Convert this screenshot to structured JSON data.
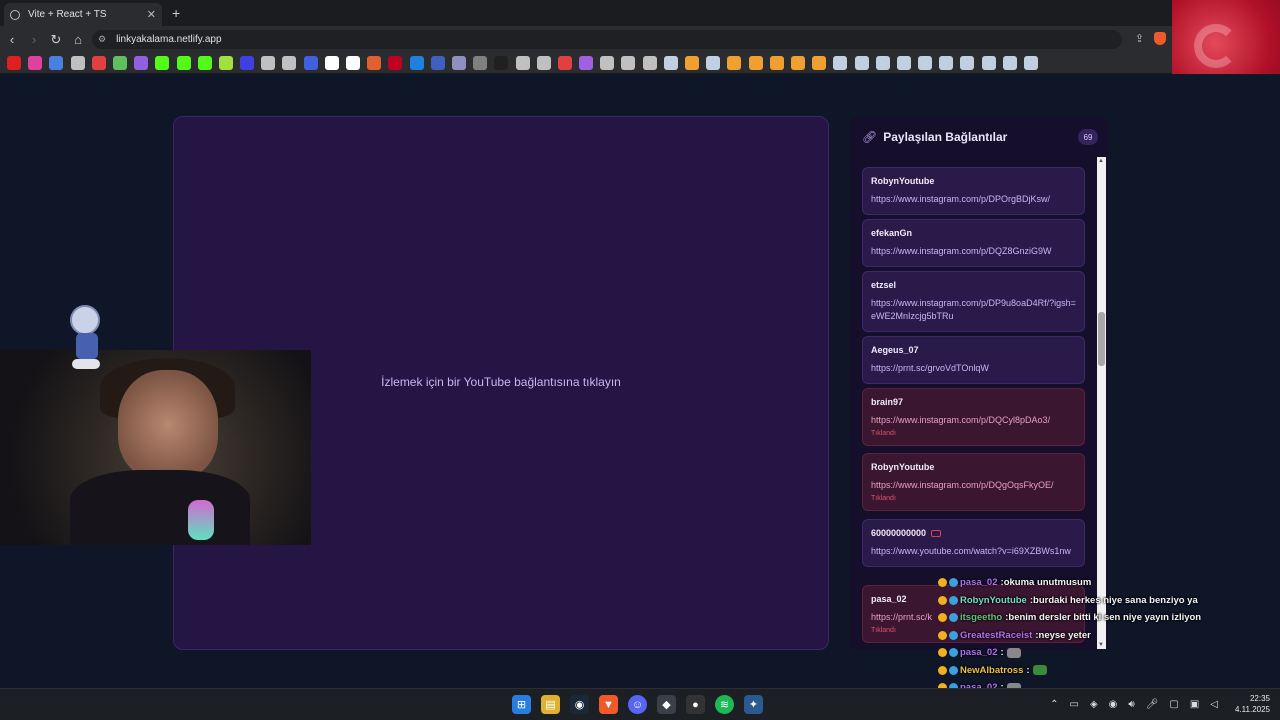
{
  "browser": {
    "tab_title": "Vite + React + TS",
    "tab_close": "✕",
    "new_tab": "+",
    "url": "linkyakalama.netlify.app",
    "back": "‹",
    "forward": "›",
    "reload": "↻",
    "bookmark_colors": [
      "#e02020",
      "#e040a0",
      "#4a80e0",
      "#c0c0c0",
      "#e04040",
      "#60c060",
      "#9060e0",
      "#53fc18",
      "#53fc18",
      "#53fc18",
      "#a0e040",
      "#4040e0",
      "#c0c0c0",
      "#c0c0c0",
      "#4060e0",
      "#ffffff",
      "#ffffff",
      "#e06030",
      "#c00020",
      "#2080e0",
      "#4060c0",
      "#9090c0",
      "#808080",
      "#202020",
      "#c0c0c0",
      "#c0c0c0",
      "#e04040",
      "#a060e0",
      "#c0c0c0",
      "#c0c0c0",
      "#c0c0c0",
      "#c0d0e0",
      "#f0a030",
      "#c0d0e0",
      "#f0a030",
      "#f0a030",
      "#f0a030",
      "#f0a030",
      "#f0a030",
      "#c0d0e0",
      "#c0d0e0",
      "#c0d0e0",
      "#c0d0e0",
      "#c0d0e0",
      "#c0d0e0",
      "#c0d0e0",
      "#c0d0e0",
      "#c0d0e0",
      "#c0d0e0"
    ]
  },
  "player": {
    "message": "İzlemek için bir YouTube bağlantısına tıklayın"
  },
  "panel": {
    "title": "Paylaşılan Bağlantılar",
    "count": "69",
    "items": [
      {
        "user": "RobynYoutube",
        "link": "https://www.instagram.com/p/DPOrgBDjKsw/",
        "status": ""
      },
      {
        "user": "efekanGn",
        "link": "https://www.instagram.com/p/DQZ8GnziG9W",
        "status": ""
      },
      {
        "user": "etzsel",
        "link": "https://www.instagram.com/p/DP9u8oaD4Rf/?igsh=eWE2MnIzcjg5bTRu",
        "status": ""
      },
      {
        "user": "Aegeus_07",
        "link": "https://prnt.sc/grvoVdTOnlqW",
        "status": ""
      },
      {
        "user": "brain97",
        "link": "https://www.instagram.com/p/DQCyl8pDAo3/",
        "status": "Tıklandı"
      },
      {
        "user": "RobynYoutube",
        "link": "https://www.instagram.com/p/DQgOqsFkyOE/",
        "status": "Tıklandı"
      },
      {
        "user": "60000000000",
        "link": "https://www.youtube.com/watch?v=i69XZBWs1nw",
        "status": ""
      },
      {
        "user": "pasa_02",
        "link": "https://prnt.sc/k",
        "status": "Tıklandı"
      }
    ]
  },
  "chat": [
    {
      "name": "pasa_02",
      "color": "#b070f0",
      "message": "okuma unutmusum"
    },
    {
      "name": "RobynYoutube",
      "color": "#70e0c0",
      "message": "burdaki herkes niye sana benziyo ya"
    },
    {
      "name": "itsgeetho",
      "color": "#60c080",
      "message": "benim dersler bitti ki sen niye yayın izliyon"
    },
    {
      "name": "GreatestRaceist",
      "color": "#b070f0",
      "message": "neyse yeter"
    },
    {
      "name": "pasa_02",
      "color": "#b070f0",
      "message": ""
    },
    {
      "name": "NewAlbatross",
      "color": "#f0c040",
      "message": ""
    },
    {
      "name": "pasa_02",
      "color": "#b070f0",
      "message": ""
    }
  ],
  "taskbar": {
    "time": "22:35",
    "date": "4.11.2025"
  }
}
